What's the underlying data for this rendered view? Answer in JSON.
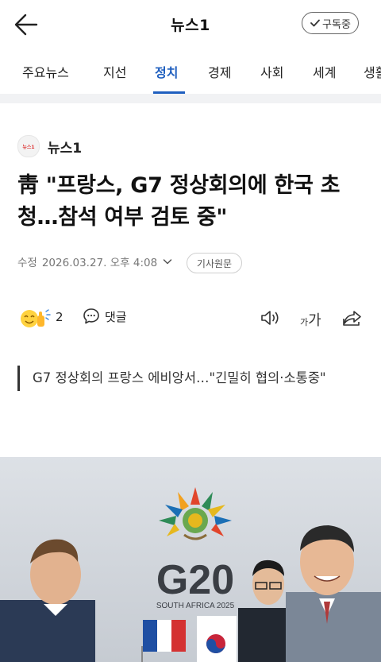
{
  "header": {
    "brand": "뉴스1",
    "subscribe_label": "구독중",
    "back_icon": "arrow-left-icon",
    "check_icon": "check-icon"
  },
  "tabs": [
    {
      "label": "주요뉴스",
      "active": false
    },
    {
      "label": "지선",
      "active": false
    },
    {
      "label": "정치",
      "active": true
    },
    {
      "label": "경제",
      "active": false
    },
    {
      "label": "사회",
      "active": false
    },
    {
      "label": "세계",
      "active": false
    },
    {
      "label": "생활",
      "active": false
    }
  ],
  "article": {
    "source_name": "뉴스1",
    "source_logo_text": "뉴스1",
    "title": "靑 \"프랑스, G7 정상회의에 한국 초청…참석 여부 검토 중\"",
    "meta_label": "수정",
    "time": "2026.03.27. 오후 4:08",
    "original_button": "기사원문",
    "reaction_count": "2",
    "comment_label": "댓글",
    "fontsize_small": "가",
    "fontsize_large": "가",
    "subtitle": "G7 정상회의 프랑스 에비앙서…\"긴밀히 협의·소통중\"",
    "photo": {
      "logo_text": "G20",
      "logo_subtext": "SOUTH AFRICA 2025"
    }
  },
  "colors": {
    "accent": "#1f5fbf",
    "separator": "#f1f2f4",
    "meta_gray": "#777777"
  }
}
